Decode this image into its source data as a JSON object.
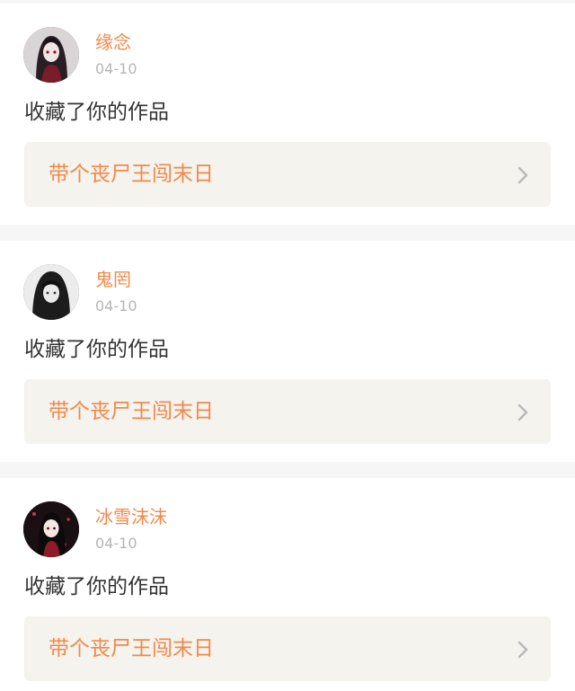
{
  "colors": {
    "accent": "#f08a4b",
    "text": "#333333",
    "muted": "#b5b5b5",
    "card_link_bg": "#f4f3ee",
    "page_bg": "#f6f6f6"
  },
  "notifications": [
    {
      "username": "缘念",
      "date": "04-10",
      "action": "收藏了你的作品",
      "work_title": "带个丧尸王闯末日",
      "avatar_icon": "avatar-anime-girl-red-icon"
    },
    {
      "username": "鬼罔",
      "date": "04-10",
      "action": "收藏了你的作品",
      "work_title": "带个丧尸王闯末日",
      "avatar_icon": "avatar-hooded-figure-icon"
    },
    {
      "username": "冰雪沫沫",
      "date": "04-10",
      "action": "收藏了你的作品",
      "work_title": "带个丧尸王闯末日",
      "avatar_icon": "avatar-anime-girl-dark-icon"
    }
  ]
}
